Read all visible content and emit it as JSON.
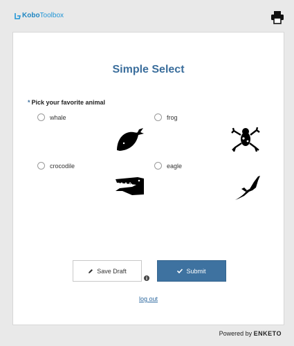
{
  "header": {
    "logo_brand_a": "Kobo",
    "logo_brand_b": "Toolbox"
  },
  "form": {
    "title": "Simple Select",
    "question_required_marker": "*",
    "question_label": "Pick your favorite animal",
    "options": [
      {
        "label": "whale",
        "image": "whale-silhouette",
        "selected": false
      },
      {
        "label": "frog",
        "image": "frog-silhouette",
        "selected": false
      },
      {
        "label": "crocodile",
        "image": "crocodile-silhouette",
        "selected": false
      },
      {
        "label": "eagle",
        "image": "eagle-silhouette",
        "selected": false
      }
    ]
  },
  "actions": {
    "save_draft_label": "Save Draft",
    "submit_label": "Submit",
    "logout_label": "log out"
  },
  "footer": {
    "powered_by": "Powered by",
    "brand": "ENKETO"
  },
  "colors": {
    "accent": "#3e72a0",
    "title": "#3b6e9c",
    "logo": "#2095d6"
  }
}
